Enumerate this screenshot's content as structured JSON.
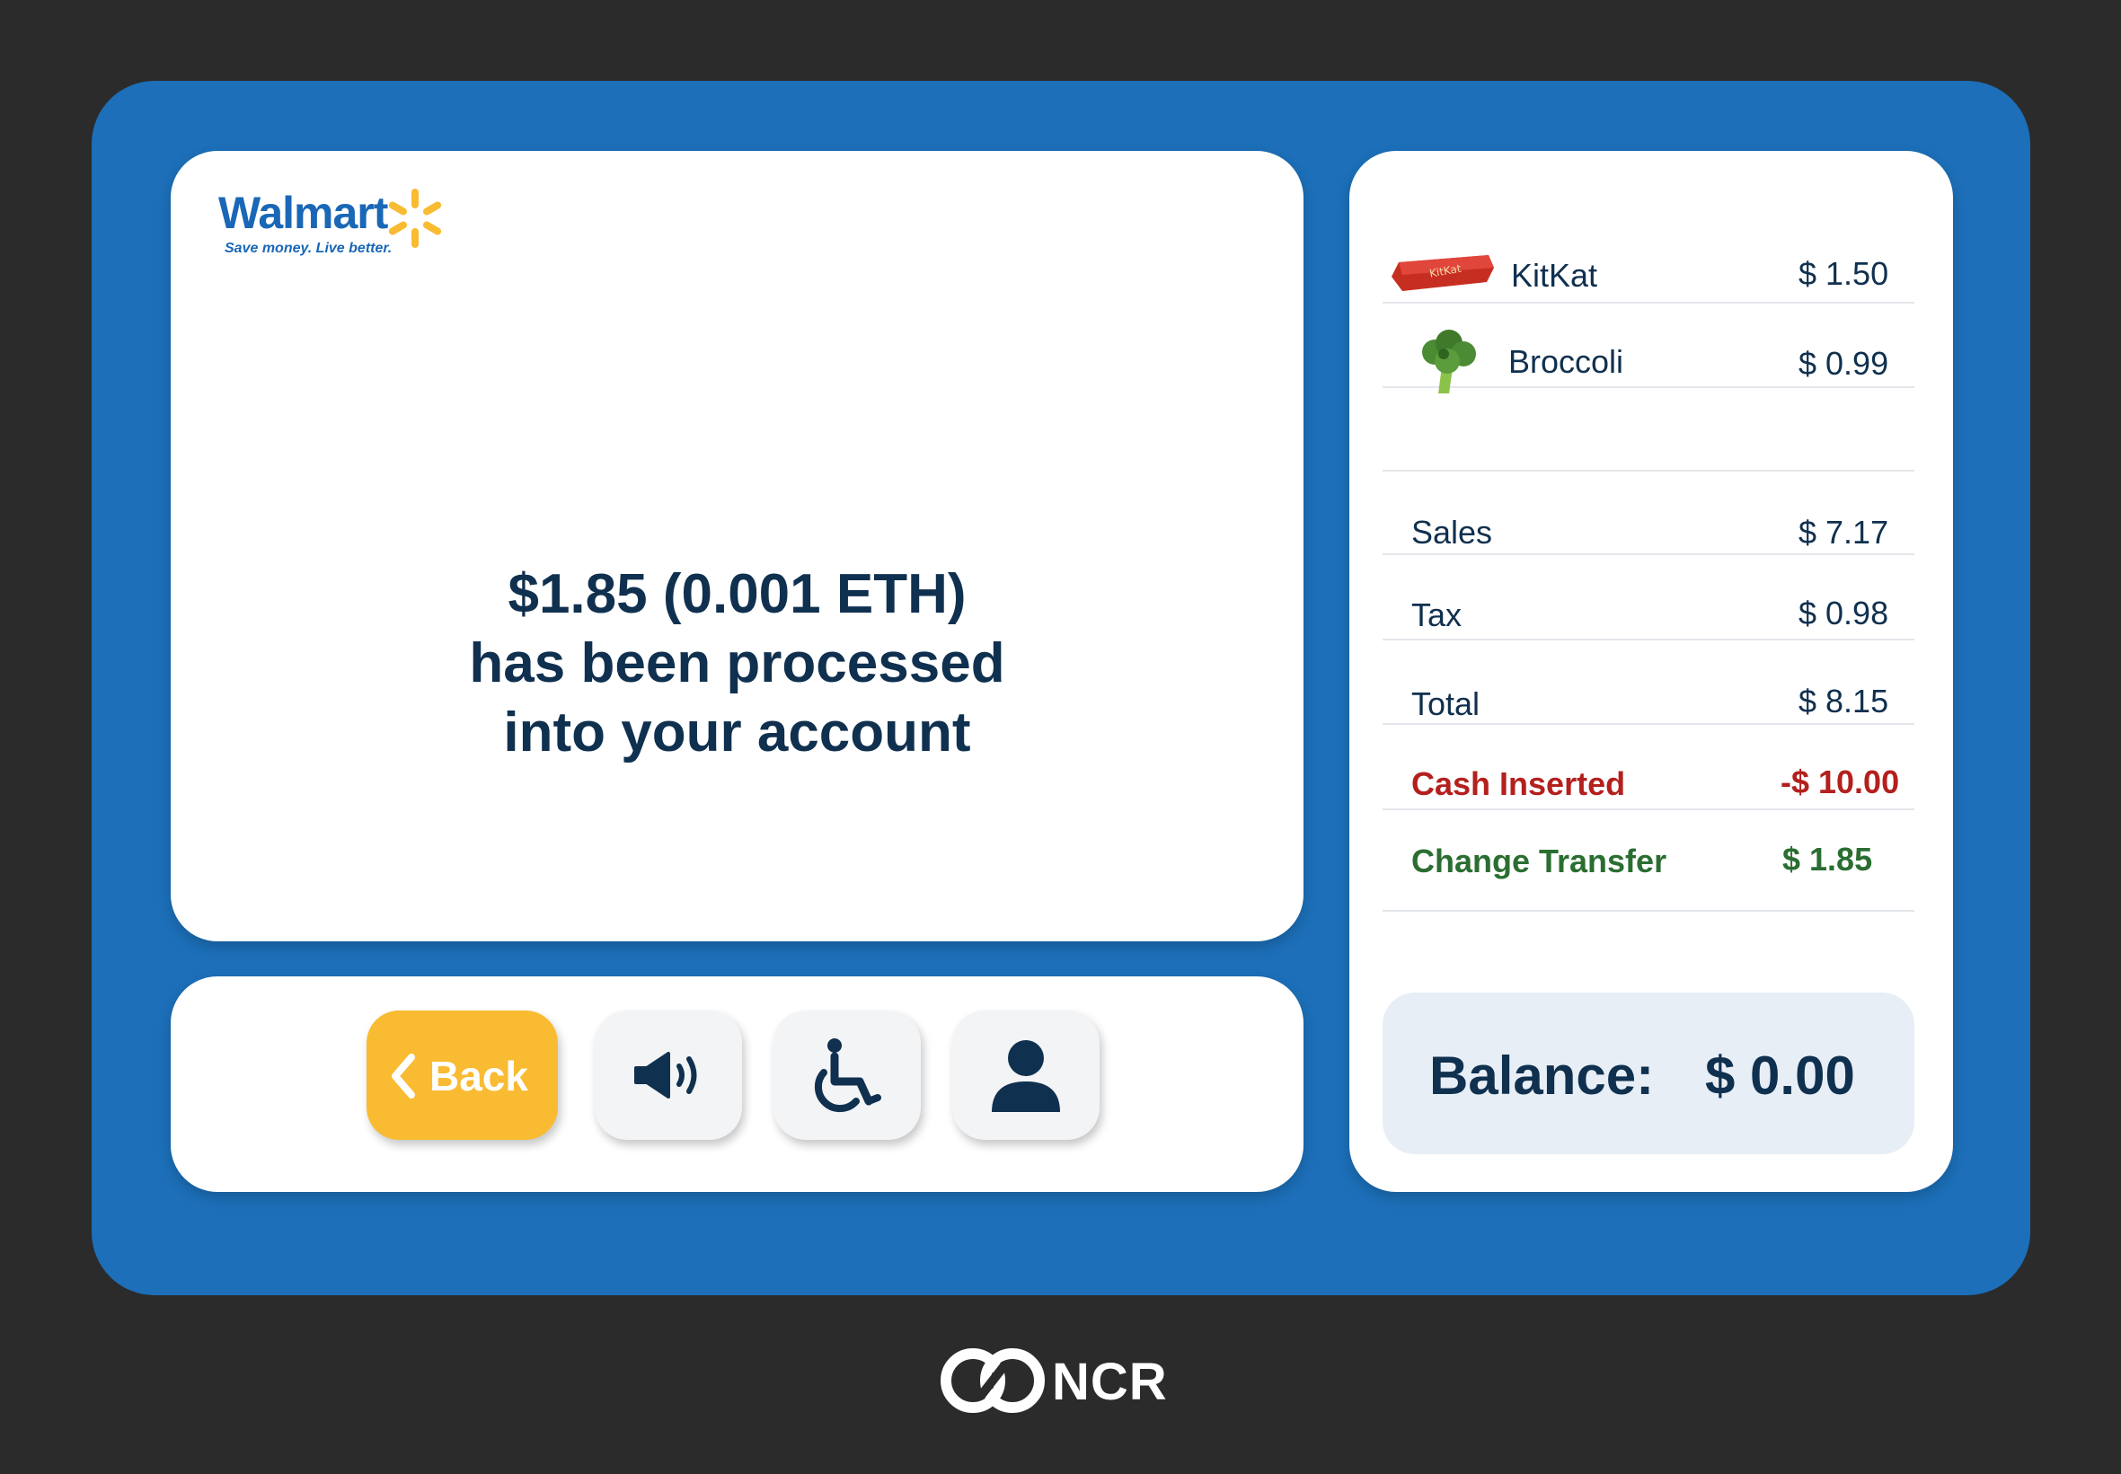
{
  "brand": {
    "name": "Walmart",
    "tagline": "Save money. Live better.",
    "color": "#1a67b7",
    "spark_color": "#f9bb32"
  },
  "message": {
    "line1": "$1.85 (0.001 ETH)",
    "line2": "has been processed",
    "line3": "into your account"
  },
  "controls": {
    "back_label": "Back",
    "audio_icon": "speaker-icon",
    "accessibility_icon": "wheelchair-icon",
    "user_icon": "user-icon"
  },
  "items": [
    {
      "name": "KitKat",
      "price": "$ 1.50",
      "icon": "kitkat-icon"
    },
    {
      "name": "Broccoli",
      "price": "$ 0.99",
      "icon": "broccoli-icon"
    }
  ],
  "summary": {
    "sales_label": "Sales",
    "sales_value": "$ 7.17",
    "tax_label": "Tax",
    "tax_value": "$ 0.98",
    "total_label": "Total",
    "total_value": "$ 8.15",
    "cash_label": "Cash Inserted",
    "cash_value": "-$ 10.00",
    "change_label": "Change Transfer",
    "change_value": "$ 1.85"
  },
  "balance": {
    "label": "Balance:",
    "value": "$ 0.00"
  },
  "footer": {
    "brand": "NCR"
  },
  "colors": {
    "background": "#2b2b2b",
    "kiosk": "#1c6fb8",
    "text": "#10304f",
    "accent": "#f9bb32",
    "negative": "#b3201e",
    "positive": "#2a6e31"
  }
}
